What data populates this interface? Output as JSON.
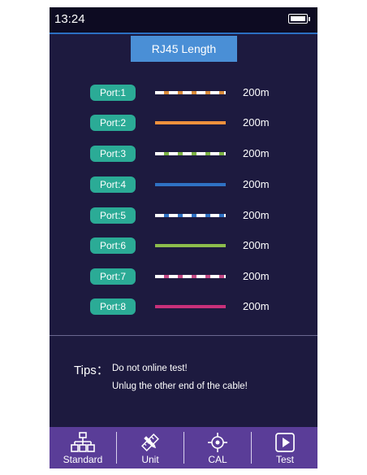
{
  "status": {
    "time": "13:24",
    "battery_icon": "battery-full-icon"
  },
  "title": "RJ45 Length",
  "ports": [
    {
      "label": "Port:1",
      "length": "200m",
      "color": "#d98b3a",
      "striped": true
    },
    {
      "label": "Port:2",
      "length": "200m",
      "color": "#f0913c",
      "striped": false
    },
    {
      "label": "Port:3",
      "length": "200m",
      "color": "#7cb244",
      "striped": true
    },
    {
      "label": "Port:4",
      "length": "200m",
      "color": "#2f72c4",
      "striped": false
    },
    {
      "label": "Port:5",
      "length": "200m",
      "color": "#2f72c4",
      "striped": true
    },
    {
      "label": "Port:6",
      "length": "200m",
      "color": "#8dbd4c",
      "striped": false
    },
    {
      "label": "Port:7",
      "length": "200m",
      "color": "#c44a86",
      "striped": true
    },
    {
      "label": "Port:8",
      "length": "200m",
      "color": "#c8307a",
      "striped": false
    }
  ],
  "tips": {
    "label": "Tips：",
    "line1": "Do not online test!",
    "line2": "Unlug the other end of the cable!"
  },
  "toolbar": [
    {
      "label": "Standard",
      "icon": "network-tree-icon"
    },
    {
      "label": "Unit",
      "icon": "ruler-pencil-icon"
    },
    {
      "label": "CAL",
      "icon": "crosshair-icon"
    },
    {
      "label": "Test",
      "icon": "play-icon"
    }
  ],
  "colors": {
    "background": "#1d1a3f",
    "accent": "#4a8fd6",
    "badge": "#2bab96",
    "toolbar": "#5a3d98"
  }
}
